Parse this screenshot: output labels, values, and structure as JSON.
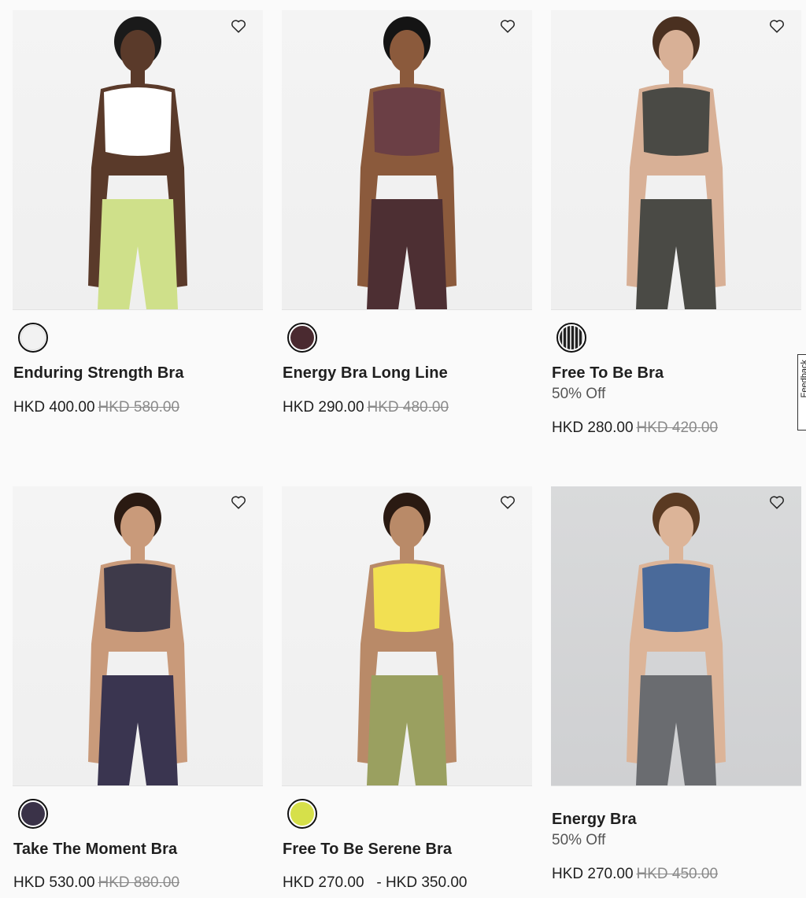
{
  "products": [
    {
      "name": "Enduring Strength Bra",
      "badge": "",
      "price": "HKD 400.00",
      "was": "HKD 580.00",
      "swatch": "#f2f2f2",
      "has_swatch": true,
      "image_bg": "light",
      "top_color": "#ffffff",
      "bottom_color": "#cfe08a",
      "skin": "#5a3a2a",
      "hair": "#1a1a1a"
    },
    {
      "name": "Energy Bra Long Line",
      "badge": "",
      "price": "HKD 290.00",
      "was": "HKD 480.00",
      "swatch": "#4a2a30",
      "has_swatch": true,
      "image_bg": "light",
      "top_color": "#6b3f45",
      "bottom_color": "#4d2f33",
      "skin": "#8b5a3c",
      "hair": "#141414"
    },
    {
      "name": "Free To Be Bra",
      "badge": "50% Off",
      "price": "HKD 280.00",
      "was": "HKD 420.00",
      "swatch": "#2b2b2b",
      "has_swatch": true,
      "image_bg": "light",
      "top_color": "#4a4a45",
      "bottom_color": "#4a4a45",
      "skin": "#d8b096",
      "hair": "#4a3020"
    },
    {
      "name": "Take The Moment Bra",
      "badge": "",
      "price": "HKD 530.00",
      "was": "HKD 880.00",
      "swatch": "#3a3248",
      "has_swatch": true,
      "image_bg": "light",
      "top_color": "#3e3a4a",
      "bottom_color": "#3a3550",
      "skin": "#c99a7a",
      "hair": "#2a1a12"
    },
    {
      "name": "Free To Be Serene Bra",
      "badge": "",
      "price": "HKD 270.00   - HKD 350.00",
      "was": "",
      "swatch": "#d6e04a",
      "has_swatch": true,
      "image_bg": "light",
      "top_color": "#f2e052",
      "bottom_color": "#9aa060",
      "skin": "#b98a68",
      "hair": "#2a1a12"
    },
    {
      "name": "Energy Bra",
      "badge": "50% Off",
      "price": "HKD 270.00",
      "was": "HKD 450.00",
      "swatch": "",
      "has_swatch": false,
      "image_bg": "grey",
      "top_color": "#4a6a9a",
      "bottom_color": "#6a6c70",
      "skin": "#dcb498",
      "hair": "#5a3a22"
    }
  ],
  "icons": {
    "wishlist": "heart-outline-icon"
  },
  "side_tab": {
    "label": "Feedback"
  }
}
